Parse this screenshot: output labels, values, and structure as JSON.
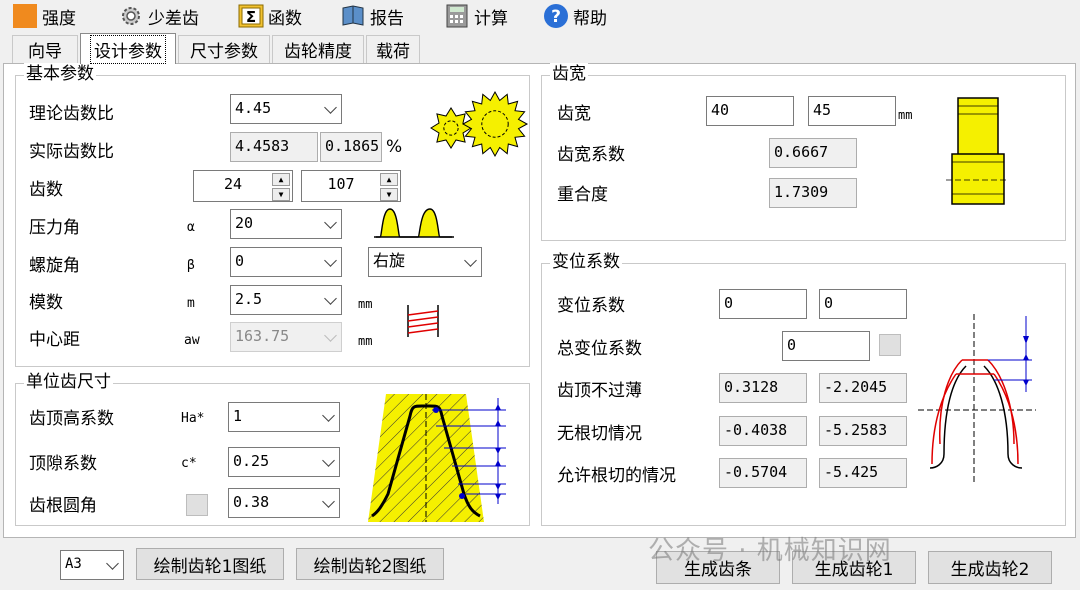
{
  "toolbar": {
    "items": [
      {
        "label": "强度",
        "icon": "orange-square-icon"
      },
      {
        "label": "少差齿",
        "icon": "gear-icon"
      },
      {
        "label": "函数",
        "icon": "sigma-icon"
      },
      {
        "label": "报告",
        "icon": "book-icon"
      },
      {
        "label": "计算",
        "icon": "calculator-icon"
      },
      {
        "label": "帮助",
        "icon": "help-icon"
      }
    ]
  },
  "tabs": [
    "向导",
    "设计参数",
    "尺寸参数",
    "齿轮精度",
    "载荷"
  ],
  "active_tab": "设计参数",
  "basic_params": {
    "title": "基本参数",
    "theoretical_ratio": {
      "label": "理论齿数比",
      "value": "4.45"
    },
    "actual_ratio": {
      "label": "实际齿数比",
      "value": "4.4583",
      "deviation": "0.1865",
      "unit": "%"
    },
    "teeth": {
      "label": "齿数",
      "z1": "24",
      "z2": "107"
    },
    "pressure_angle": {
      "label": "压力角",
      "symbol": "α",
      "value": "20"
    },
    "helix_angle": {
      "label": "螺旋角",
      "symbol": "β",
      "value": "0",
      "hand": "右旋"
    },
    "module": {
      "label": "模数",
      "symbol": "m",
      "value": "2.5",
      "unit": "mm"
    },
    "center_distance": {
      "label": "中心距",
      "symbol": "aw",
      "value": "163.75",
      "unit": "mm"
    }
  },
  "unit_tooth": {
    "title": "单位齿尺寸",
    "addendum": {
      "label": "齿顶高系数",
      "symbol": "Ha*",
      "value": "1"
    },
    "clearance": {
      "label": "顶隙系数",
      "symbol": "c*",
      "value": "0.25"
    },
    "root_fillet": {
      "label": "齿根圆角",
      "value": "0.38"
    }
  },
  "face_width": {
    "title": "齿宽",
    "width": {
      "label": "齿宽",
      "b1": "40",
      "b2": "45",
      "unit": "mm"
    },
    "coefficient": {
      "label": "齿宽系数",
      "value": "0.6667"
    },
    "overlap": {
      "label": "重合度",
      "value": "1.7309"
    }
  },
  "shift": {
    "title": "变位系数",
    "coef": {
      "label": "变位系数",
      "x1": "0",
      "x2": "0"
    },
    "total": {
      "label": "总变位系数",
      "value": "0"
    },
    "tip": {
      "label": "齿顶不过薄",
      "v1": "0.3128",
      "v2": "-2.2045"
    },
    "no_undercut": {
      "label": "无根切情况",
      "v1": "-0.4038",
      "v2": "-5.2583"
    },
    "allow_undercut": {
      "label": "允许根切的情况",
      "v1": "-0.5704",
      "v2": "-5.425"
    }
  },
  "bottom": {
    "paper": "A3",
    "draw1": "绘制齿轮1图纸",
    "draw2": "绘制齿轮2图纸",
    "gen_rack": "生成齿条",
    "gen_gear1": "生成齿轮1",
    "gen_gear2": "生成齿轮2"
  },
  "watermark": "公众号 · 机械知识网",
  "colors": {
    "gear_yellow": "#f5f000",
    "accent_blue": "#0000cc",
    "accent_red": "#e00000"
  }
}
